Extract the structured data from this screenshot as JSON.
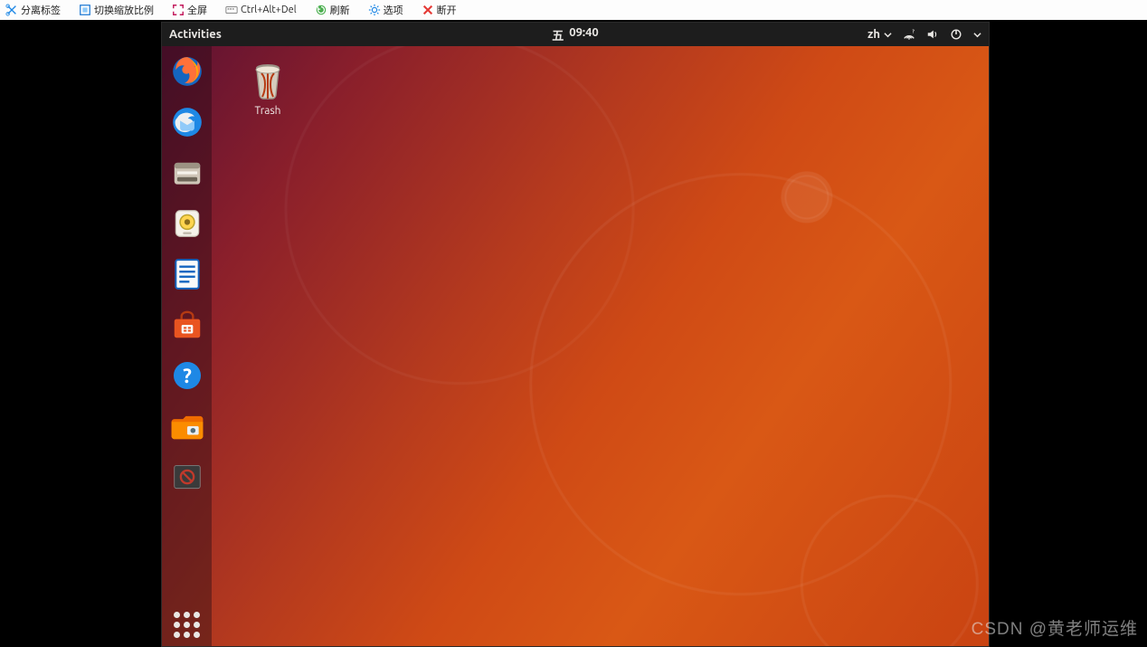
{
  "vb_toolbar": {
    "items": [
      {
        "label": "分离标签",
        "icon": "scissors"
      },
      {
        "label": "切换缩放比例",
        "icon": "scale"
      },
      {
        "label": "全屏",
        "icon": "fullscreen"
      },
      {
        "label": "Ctrl+Alt+Del",
        "icon": "keyboard"
      },
      {
        "label": "刷新",
        "icon": "refresh"
      },
      {
        "label": "选项",
        "icon": "gear"
      },
      {
        "label": "断开",
        "icon": "close"
      }
    ]
  },
  "topbar": {
    "activities": "Activities",
    "clock_day": "五",
    "clock_time": "09:40",
    "input_method": "zh"
  },
  "dock": {
    "items": [
      {
        "name": "firefox"
      },
      {
        "name": "thunderbird"
      },
      {
        "name": "files"
      },
      {
        "name": "rhythmbox"
      },
      {
        "name": "writer"
      },
      {
        "name": "software"
      },
      {
        "name": "help"
      },
      {
        "name": "screenshot-folder"
      },
      {
        "name": "disabled-app"
      }
    ],
    "show_apps_label": "Show Applications"
  },
  "desktop": {
    "trash": {
      "label": "Trash"
    }
  },
  "watermark": "CSDN @黄老师运维"
}
